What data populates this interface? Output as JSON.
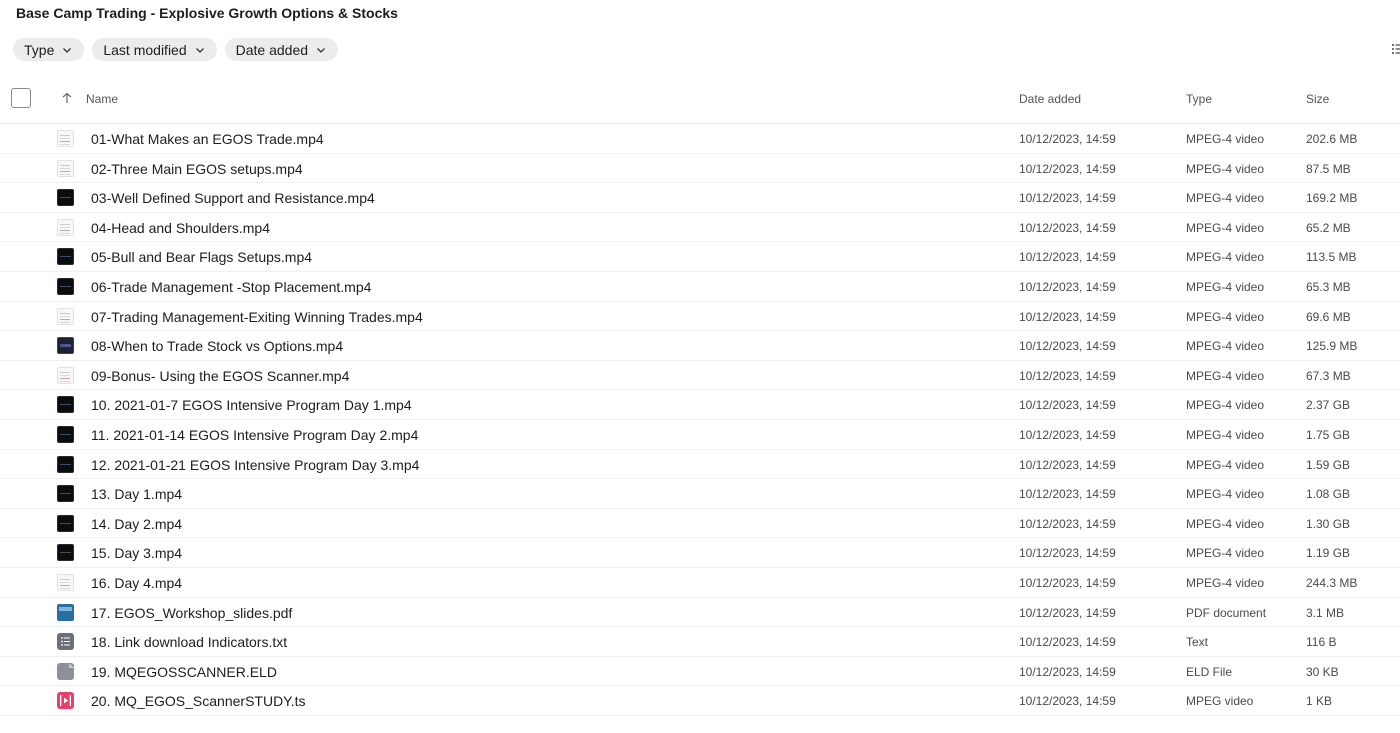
{
  "page": {
    "title": "Base Camp Trading - Explosive Growth Options & Stocks"
  },
  "filters": [
    {
      "label": "Type"
    },
    {
      "label": "Last modified"
    },
    {
      "label": "Date added"
    }
  ],
  "columns": {
    "name": "Name",
    "date_added": "Date added",
    "type": "Type",
    "size": "Size"
  },
  "sort": {
    "column": "Name",
    "direction": "ascending"
  },
  "files": [
    {
      "name": "01-What Makes an EGOS Trade.mp4",
      "date": "10/12/2023, 14:59",
      "type": "MPEG-4 video",
      "size": "202.6 MB",
      "thumb": "light"
    },
    {
      "name": "02-Three Main EGOS setups.mp4",
      "date": "10/12/2023, 14:59",
      "type": "MPEG-4 video",
      "size": "87.5 MB",
      "thumb": "light"
    },
    {
      "name": "03-Well Defined Support and Resistance.mp4",
      "date": "10/12/2023, 14:59",
      "type": "MPEG-4 video",
      "size": "169.2 MB",
      "thumb": "dark"
    },
    {
      "name": "04-Head and Shoulders.mp4",
      "date": "10/12/2023, 14:59",
      "type": "MPEG-4 video",
      "size": "65.2 MB",
      "thumb": "light"
    },
    {
      "name": "05-Bull and Bear Flags Setups.mp4",
      "date": "10/12/2023, 14:59",
      "type": "MPEG-4 video",
      "size": "113.5 MB",
      "thumb": "dark"
    },
    {
      "name": "06-Trade Management -Stop Placement.mp4",
      "date": "10/12/2023, 14:59",
      "type": "MPEG-4 video",
      "size": "65.3 MB",
      "thumb": "dark"
    },
    {
      "name": "07-Trading Management-Exiting Winning Trades.mp4",
      "date": "10/12/2023, 14:59",
      "type": "MPEG-4 video",
      "size": "69.6 MB",
      "thumb": "light"
    },
    {
      "name": "08-When to Trade Stock vs Options.mp4",
      "date": "10/12/2023, 14:59",
      "type": "MPEG-4 video",
      "size": "125.9 MB",
      "thumb": "navy"
    },
    {
      "name": "09-Bonus- Using the EGOS Scanner.mp4",
      "date": "10/12/2023, 14:59",
      "type": "MPEG-4 video",
      "size": "67.3 MB",
      "thumb": "light"
    },
    {
      "name": "10. 2021-01-7 EGOS Intensive Program Day 1.mp4",
      "date": "10/12/2023, 14:59",
      "type": "MPEG-4 video",
      "size": "2.37 GB",
      "thumb": "dark"
    },
    {
      "name": "11. 2021-01-14 EGOS Intensive Program Day 2.mp4",
      "date": "10/12/2023, 14:59",
      "type": "MPEG-4 video",
      "size": "1.75 GB",
      "thumb": "dark"
    },
    {
      "name": "12. 2021-01-21 EGOS Intensive Program Day 3.mp4",
      "date": "10/12/2023, 14:59",
      "type": "MPEG-4 video",
      "size": "1.59 GB",
      "thumb": "dark"
    },
    {
      "name": "13. Day 1.mp4",
      "date": "10/12/2023, 14:59",
      "type": "MPEG-4 video",
      "size": "1.08 GB",
      "thumb": "dark"
    },
    {
      "name": "14. Day 2.mp4",
      "date": "10/12/2023, 14:59",
      "type": "MPEG-4 video",
      "size": "1.30 GB",
      "thumb": "dark"
    },
    {
      "name": "15. Day 3.mp4",
      "date": "10/12/2023, 14:59",
      "type": "MPEG-4 video",
      "size": "1.19 GB",
      "thumb": "dark"
    },
    {
      "name": "16. Day 4.mp4",
      "date": "10/12/2023, 14:59",
      "type": "MPEG-4 video",
      "size": "244.3 MB",
      "thumb": "light"
    },
    {
      "name": "17. EGOS_Workshop_slides.pdf",
      "date": "10/12/2023, 14:59",
      "type": "PDF document",
      "size": "3.1 MB",
      "thumb": "pdf"
    },
    {
      "name": "18. Link download Indicators.txt",
      "date": "10/12/2023, 14:59",
      "type": "Text",
      "size": "116 B",
      "thumb": "txt"
    },
    {
      "name": "19. MQEGOSSCANNER.ELD",
      "date": "10/12/2023, 14:59",
      "type": "ELD File",
      "size": "30 KB",
      "thumb": "generic"
    },
    {
      "name": "20. MQ_EGOS_ScannerSTUDY.ts",
      "date": "10/12/2023, 14:59",
      "type": "MPEG video",
      "size": "1 KB",
      "thumb": "ts"
    }
  ]
}
